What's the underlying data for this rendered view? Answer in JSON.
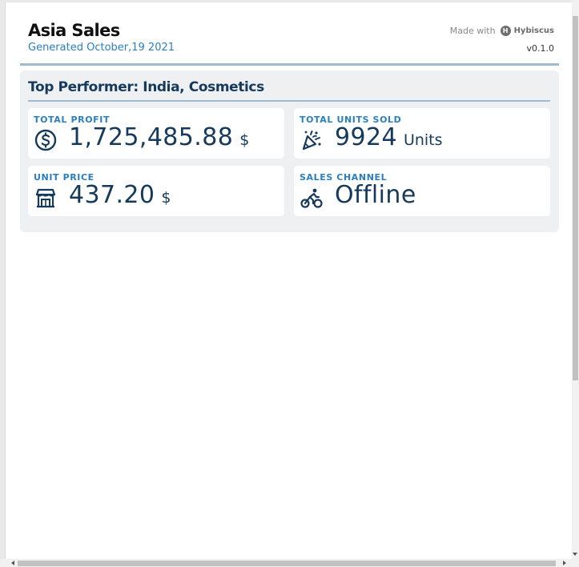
{
  "header": {
    "title": "Asia Sales",
    "subtitle": "Generated October,19 2021",
    "made_with_label": "Made with",
    "brand_logo_letter": "H",
    "brand_name": "Hybiscus",
    "version": "v0.1.0"
  },
  "panel": {
    "title": "Top Performer: India, Cosmetics",
    "cards": [
      {
        "label": "TOTAL PROFIT",
        "value": "1,725,485.88",
        "unit": "$",
        "icon": "dollar-circle-icon"
      },
      {
        "label": "TOTAL UNITS SOLD",
        "value": "9924",
        "unit": "Units",
        "icon": "confetti-icon"
      },
      {
        "label": "UNIT PRICE",
        "value": "437.20",
        "unit": "$",
        "icon": "storefront-icon"
      },
      {
        "label": "SALES CHANNEL",
        "value": "Offline",
        "unit": "",
        "icon": "bicycle-icon"
      }
    ]
  },
  "colors": {
    "accent_blue": "#2a7fc0",
    "navy": "#163a5c",
    "divider": "#9dbbd3",
    "panel_bg": "#eef0f2"
  }
}
